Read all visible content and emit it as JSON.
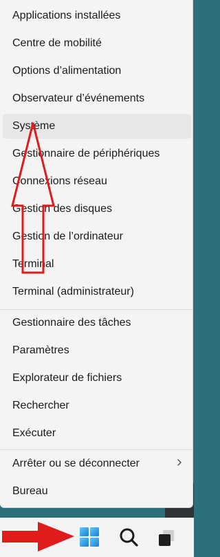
{
  "menu": {
    "group1": [
      "Applications installées",
      "Centre de mobilité",
      "Options d’alimentation",
      "Observateur d’événements",
      "Système",
      "Gestionnaire de périphériques",
      "Connexions réseau",
      "Gestion des disques",
      "Gestion de l’ordinateur",
      "Terminal",
      "Terminal (administrateur)"
    ],
    "group2": [
      "Gestionnaire des tâches",
      "Paramètres",
      "Explorateur de fichiers",
      "Rechercher",
      "Exécuter"
    ],
    "group3": [
      "Arrêter ou se déconnecter",
      "Bureau"
    ],
    "highlighted_item": "Système"
  },
  "taskbar": {
    "icons": [
      "windows-start-icon",
      "search-icon",
      "task-view-icon"
    ]
  },
  "annotations": {
    "arrow_color": "#e01b1b"
  },
  "colors": {
    "menu_bg": "#f4f4f4",
    "highlight_bg": "#e7e7e7",
    "windows_blue": "#1f8ad8"
  }
}
